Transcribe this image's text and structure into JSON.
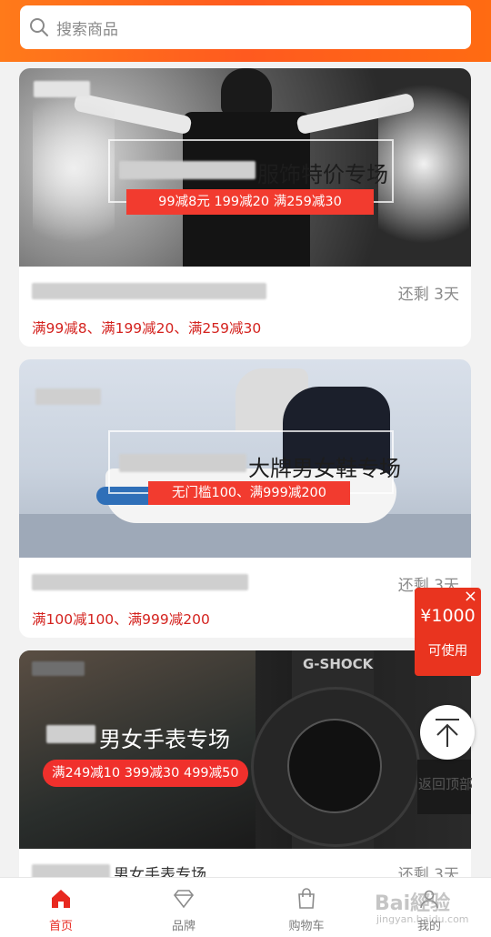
{
  "search": {
    "placeholder": "搜索商品"
  },
  "cards": [
    {
      "banner_title": "服饰特价专场",
      "banner_badge": "99减8元  199减20  满259减30",
      "remaining": "还剩 3天",
      "promo": "满99减8、满199减20、满259减30"
    },
    {
      "banner_title": "大牌男女鞋专场",
      "banner_badge": "无门槛100、满999减200",
      "remaining": "还剩 3天",
      "promo": "满100减100、满999减200"
    },
    {
      "banner_title": "男女手表专场",
      "banner_badge": "满249减10 399减30 499减50",
      "watch_brand": "G-SHOCK",
      "remaining": "还剩 3天",
      "name_suffix": "男女手表专场"
    }
  ],
  "coupon": {
    "close": "×",
    "amount": "¥1000",
    "use": "可使用"
  },
  "back_to_top": "返回顶部",
  "tabs": [
    {
      "label": "首页",
      "icon": "home-icon",
      "active": true
    },
    {
      "label": "品牌",
      "icon": "diamond-icon",
      "active": false
    },
    {
      "label": "购物车",
      "icon": "shopping-bag-icon",
      "active": false
    },
    {
      "label": "我的",
      "icon": "user-icon",
      "active": false
    }
  ],
  "watermark": {
    "main": "Bai經验",
    "sub": "jingyan.baidu.com"
  },
  "colors": {
    "accent": "#e8281f",
    "header_start": "#ff7a1a",
    "header_end": "#ff5a1f",
    "promo_text": "#d4231f"
  }
}
